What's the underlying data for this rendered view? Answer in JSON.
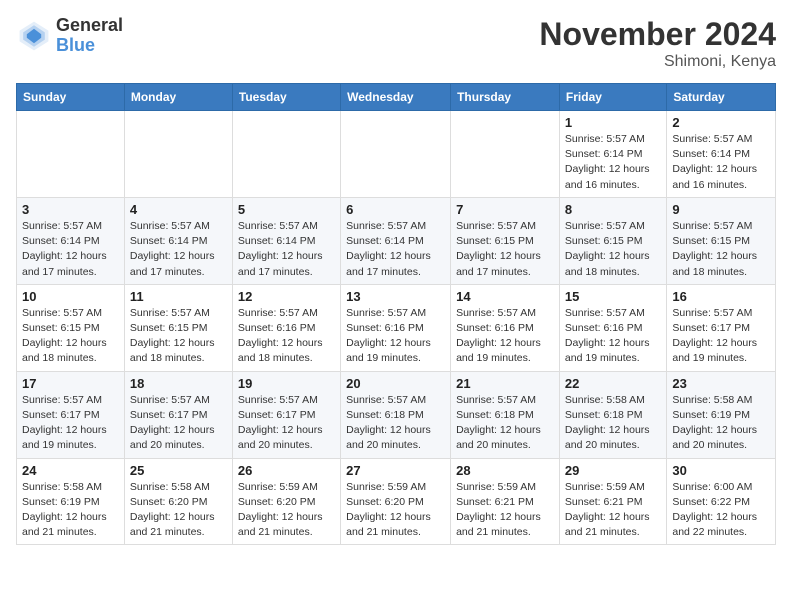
{
  "logo": {
    "general": "General",
    "blue": "Blue"
  },
  "title": "November 2024",
  "location": "Shimoni, Kenya",
  "weekdays": [
    "Sunday",
    "Monday",
    "Tuesday",
    "Wednesday",
    "Thursday",
    "Friday",
    "Saturday"
  ],
  "weeks": [
    [
      {
        "day": "",
        "info": ""
      },
      {
        "day": "",
        "info": ""
      },
      {
        "day": "",
        "info": ""
      },
      {
        "day": "",
        "info": ""
      },
      {
        "day": "",
        "info": ""
      },
      {
        "day": "1",
        "info": "Sunrise: 5:57 AM\nSunset: 6:14 PM\nDaylight: 12 hours\nand 16 minutes."
      },
      {
        "day": "2",
        "info": "Sunrise: 5:57 AM\nSunset: 6:14 PM\nDaylight: 12 hours\nand 16 minutes."
      }
    ],
    [
      {
        "day": "3",
        "info": "Sunrise: 5:57 AM\nSunset: 6:14 PM\nDaylight: 12 hours\nand 17 minutes."
      },
      {
        "day": "4",
        "info": "Sunrise: 5:57 AM\nSunset: 6:14 PM\nDaylight: 12 hours\nand 17 minutes."
      },
      {
        "day": "5",
        "info": "Sunrise: 5:57 AM\nSunset: 6:14 PM\nDaylight: 12 hours\nand 17 minutes."
      },
      {
        "day": "6",
        "info": "Sunrise: 5:57 AM\nSunset: 6:14 PM\nDaylight: 12 hours\nand 17 minutes."
      },
      {
        "day": "7",
        "info": "Sunrise: 5:57 AM\nSunset: 6:15 PM\nDaylight: 12 hours\nand 17 minutes."
      },
      {
        "day": "8",
        "info": "Sunrise: 5:57 AM\nSunset: 6:15 PM\nDaylight: 12 hours\nand 18 minutes."
      },
      {
        "day": "9",
        "info": "Sunrise: 5:57 AM\nSunset: 6:15 PM\nDaylight: 12 hours\nand 18 minutes."
      }
    ],
    [
      {
        "day": "10",
        "info": "Sunrise: 5:57 AM\nSunset: 6:15 PM\nDaylight: 12 hours\nand 18 minutes."
      },
      {
        "day": "11",
        "info": "Sunrise: 5:57 AM\nSunset: 6:15 PM\nDaylight: 12 hours\nand 18 minutes."
      },
      {
        "day": "12",
        "info": "Sunrise: 5:57 AM\nSunset: 6:16 PM\nDaylight: 12 hours\nand 18 minutes."
      },
      {
        "day": "13",
        "info": "Sunrise: 5:57 AM\nSunset: 6:16 PM\nDaylight: 12 hours\nand 19 minutes."
      },
      {
        "day": "14",
        "info": "Sunrise: 5:57 AM\nSunset: 6:16 PM\nDaylight: 12 hours\nand 19 minutes."
      },
      {
        "day": "15",
        "info": "Sunrise: 5:57 AM\nSunset: 6:16 PM\nDaylight: 12 hours\nand 19 minutes."
      },
      {
        "day": "16",
        "info": "Sunrise: 5:57 AM\nSunset: 6:17 PM\nDaylight: 12 hours\nand 19 minutes."
      }
    ],
    [
      {
        "day": "17",
        "info": "Sunrise: 5:57 AM\nSunset: 6:17 PM\nDaylight: 12 hours\nand 19 minutes."
      },
      {
        "day": "18",
        "info": "Sunrise: 5:57 AM\nSunset: 6:17 PM\nDaylight: 12 hours\nand 20 minutes."
      },
      {
        "day": "19",
        "info": "Sunrise: 5:57 AM\nSunset: 6:17 PM\nDaylight: 12 hours\nand 20 minutes."
      },
      {
        "day": "20",
        "info": "Sunrise: 5:57 AM\nSunset: 6:18 PM\nDaylight: 12 hours\nand 20 minutes."
      },
      {
        "day": "21",
        "info": "Sunrise: 5:57 AM\nSunset: 6:18 PM\nDaylight: 12 hours\nand 20 minutes."
      },
      {
        "day": "22",
        "info": "Sunrise: 5:58 AM\nSunset: 6:18 PM\nDaylight: 12 hours\nand 20 minutes."
      },
      {
        "day": "23",
        "info": "Sunrise: 5:58 AM\nSunset: 6:19 PM\nDaylight: 12 hours\nand 20 minutes."
      }
    ],
    [
      {
        "day": "24",
        "info": "Sunrise: 5:58 AM\nSunset: 6:19 PM\nDaylight: 12 hours\nand 21 minutes."
      },
      {
        "day": "25",
        "info": "Sunrise: 5:58 AM\nSunset: 6:20 PM\nDaylight: 12 hours\nand 21 minutes."
      },
      {
        "day": "26",
        "info": "Sunrise: 5:59 AM\nSunset: 6:20 PM\nDaylight: 12 hours\nand 21 minutes."
      },
      {
        "day": "27",
        "info": "Sunrise: 5:59 AM\nSunset: 6:20 PM\nDaylight: 12 hours\nand 21 minutes."
      },
      {
        "day": "28",
        "info": "Sunrise: 5:59 AM\nSunset: 6:21 PM\nDaylight: 12 hours\nand 21 minutes."
      },
      {
        "day": "29",
        "info": "Sunrise: 5:59 AM\nSunset: 6:21 PM\nDaylight: 12 hours\nand 21 minutes."
      },
      {
        "day": "30",
        "info": "Sunrise: 6:00 AM\nSunset: 6:22 PM\nDaylight: 12 hours\nand 22 minutes."
      }
    ]
  ]
}
